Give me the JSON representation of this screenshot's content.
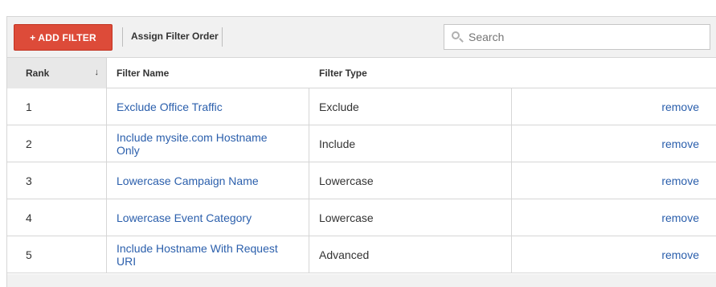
{
  "toolbar": {
    "add_filter_label": "+ ADD FILTER",
    "assign_order_label": "Assign Filter Order",
    "search_placeholder": "Search",
    "search_value": ""
  },
  "table": {
    "headers": {
      "rank": "Rank",
      "name": "Filter Name",
      "type": "Filter Type"
    },
    "sort_indicator": "↓",
    "rows": [
      {
        "rank": "1",
        "name": "Exclude Office Traffic",
        "type": "Exclude",
        "action": "remove"
      },
      {
        "rank": "2",
        "name": "Include mysite.com Hostname Only",
        "type": "Include",
        "action": "remove"
      },
      {
        "rank": "3",
        "name": "Lowercase Campaign Name",
        "type": "Lowercase",
        "action": "remove"
      },
      {
        "rank": "4",
        "name": "Lowercase Event Category",
        "type": "Lowercase",
        "action": "remove"
      },
      {
        "rank": "5",
        "name": "Include Hostname With Request URI",
        "type": "Advanced",
        "action": "remove"
      }
    ]
  },
  "colors": {
    "primary_button": "#dd4b39",
    "link": "#2b5fac"
  },
  "icons": {
    "search": "search-icon",
    "sort": "sort-down-arrow-icon"
  }
}
